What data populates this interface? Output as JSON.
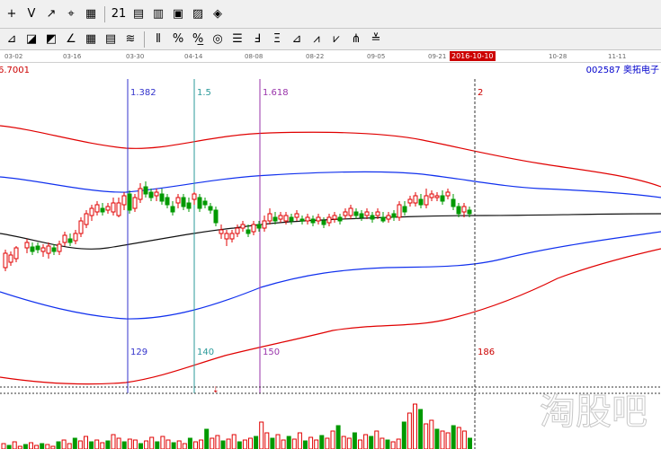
{
  "toolbar1": {
    "items": [
      {
        "name": "crosshair-button",
        "glyph": "+"
      },
      {
        "name": "line-draw-button",
        "glyph": "V"
      },
      {
        "name": "arrow-draw-button",
        "glyph": "↗"
      },
      {
        "name": "price-label-button",
        "glyph": "⌖"
      },
      {
        "name": "gann-button",
        "glyph": "▦"
      },
      {
        "name": "calendar-button",
        "glyph": "21"
      },
      {
        "name": "calculator-button",
        "glyph": "▤"
      },
      {
        "name": "report-button",
        "glyph": "▥"
      },
      {
        "name": "save-button",
        "glyph": "▣"
      },
      {
        "name": "export-button",
        "glyph": "▨"
      },
      {
        "name": "network-button",
        "glyph": "◈"
      }
    ]
  },
  "toolbar2": {
    "items": [
      {
        "name": "fan-line-button",
        "glyph": "⊿"
      },
      {
        "name": "speed-resistance-button",
        "glyph": "◪"
      },
      {
        "name": "gann-fan-button",
        "glyph": "◩"
      },
      {
        "name": "angle-line-button",
        "glyph": "∠"
      },
      {
        "name": "grid-button",
        "glyph": "▦"
      },
      {
        "name": "box-grid-button",
        "glyph": "▤"
      },
      {
        "name": "parallel-button",
        "glyph": "≋"
      },
      {
        "name": "fib-timezone-button",
        "glyph": "⫴"
      },
      {
        "name": "percent-button",
        "glyph": "%"
      },
      {
        "name": "percent-line-button",
        "glyph": "%̲"
      },
      {
        "name": "cycle-button",
        "glyph": "◎"
      },
      {
        "name": "fib-retrace-button",
        "glyph": "☰"
      },
      {
        "name": "fib-line-button",
        "glyph": "Ⅎ"
      },
      {
        "name": "fib-fan-button",
        "glyph": "Ξ"
      },
      {
        "name": "fib-arc-button",
        "glyph": "⊿"
      },
      {
        "name": "fib-spiral-button",
        "glyph": "⩘"
      },
      {
        "name": "andrews-button",
        "glyph": "⩗"
      },
      {
        "name": "pitchfork-button",
        "glyph": "⋔"
      },
      {
        "name": "wave-button",
        "glyph": "≚"
      }
    ]
  },
  "dates": {
    "ticks": [
      "03-02",
      "03-16",
      "03-30",
      "04-14",
      "08-08",
      "08-22",
      "09-05",
      "09-21",
      "10-28",
      "11-11"
    ],
    "highlight": "2016-10-10"
  },
  "price_label": "6.7001",
  "stock_label": "002587  奥拓电子",
  "watermark": "淘股吧",
  "chart_data": {
    "type": "candlestick",
    "fib_time_lines": [
      {
        "label_top": "1.382",
        "label_bottom": "129",
        "color": "#3333cc"
      },
      {
        "label_top": "1.5",
        "label_bottom": "140",
        "color": "#2b9a9a"
      },
      {
        "label_top": "1.618",
        "label_bottom": "150",
        "color": "#9933aa"
      },
      {
        "label_top": "2",
        "label_bottom": "186",
        "color": "#cc0000"
      }
    ],
    "candles_desc": "daily price candles, red=up, green=down"
  },
  "colors": {
    "up": "#e00000",
    "down": "#009900",
    "outer_band": "#e00000",
    "inner_band": "#0033ff",
    "mid": "#000000"
  }
}
